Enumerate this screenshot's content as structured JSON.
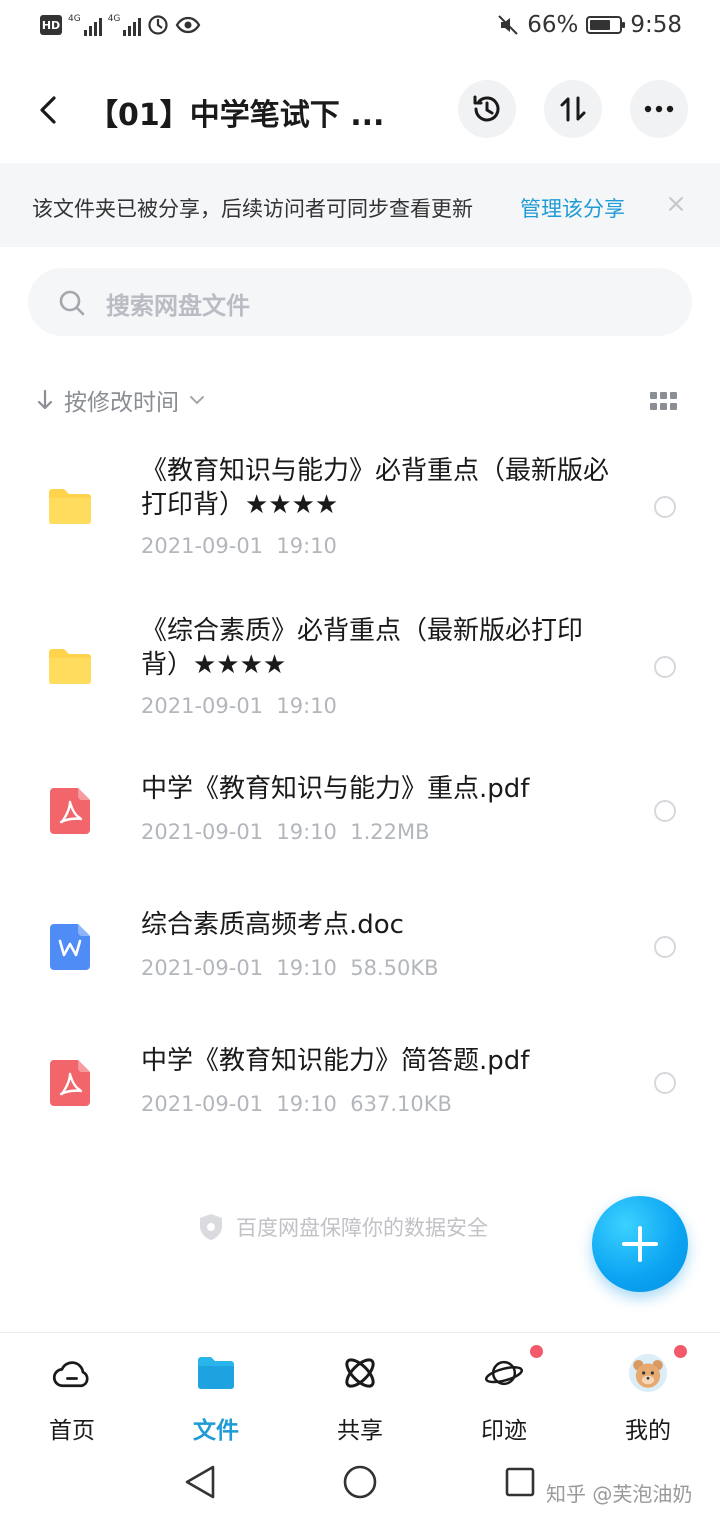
{
  "status_bar": {
    "hd": "HD",
    "net1": "4G",
    "net2": "4G",
    "battery_percent": "66%",
    "time": "9:58"
  },
  "header": {
    "title": "【01】中学笔试下 ..."
  },
  "banner": {
    "text": "该文件夹已被分享，后续访问者可同步查看更新",
    "link": "管理该分享",
    "close": "×"
  },
  "search": {
    "placeholder": "搜索网盘文件"
  },
  "sort": {
    "label": "按修改时间"
  },
  "files": [
    {
      "name": "《教育知识与能力》必背重点（最新版必打印背）★★★★",
      "meta": "2021-09-01  19:10",
      "type": "folder"
    },
    {
      "name": "《综合素质》必背重点（最新版必打印背）★★★★",
      "meta": "2021-09-01  19:10",
      "type": "folder"
    },
    {
      "name": "中学《教育知识与能力》重点.pdf",
      "meta": "2021-09-01  19:10  1.22MB",
      "type": "pdf"
    },
    {
      "name": "综合素质高频考点.doc",
      "meta": "2021-09-01  19:10  58.50KB",
      "type": "doc"
    },
    {
      "name": "中学《教育知识能力》简答题.pdf",
      "meta": "2021-09-01  19:10  637.10KB",
      "type": "pdf"
    }
  ],
  "footer": {
    "security_text": "百度网盘保障你的数据安全"
  },
  "tabs": [
    {
      "label": "首页",
      "icon": "cloud-icon"
    },
    {
      "label": "文件",
      "icon": "folder-icon",
      "active": true
    },
    {
      "label": "共享",
      "icon": "atom-icon"
    },
    {
      "label": "印迹",
      "icon": "planet-icon",
      "badge": true
    },
    {
      "label": "我的",
      "icon": "avatar",
      "badge": true
    }
  ],
  "watermark": "知乎 @芙泡油奶",
  "colors": {
    "accent": "#1f9bd6",
    "folder": "#ffd34d",
    "pdf": "#f2656b",
    "doc": "#4f8cf5",
    "badge": "#f25a6b"
  }
}
